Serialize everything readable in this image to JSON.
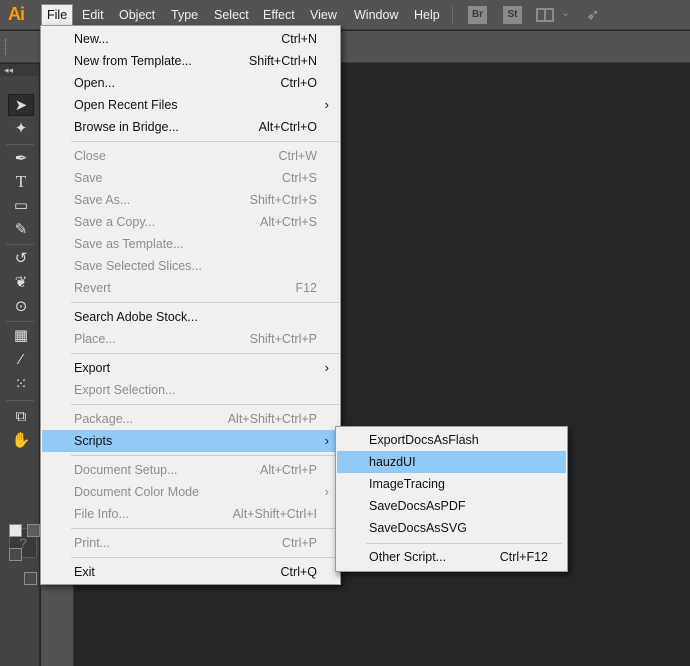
{
  "app": {
    "logo": "Ai",
    "bridge_badge": "Br",
    "stock_badge": "St"
  },
  "menubar": {
    "items": [
      "File",
      "Edit",
      "Object",
      "Type",
      "Select",
      "Effect",
      "View",
      "Window",
      "Help"
    ],
    "active": "File"
  },
  "tools_panel": {
    "collapse_label": "◂◂",
    "help_glyph": "?"
  },
  "file_menu": {
    "items": [
      {
        "label": "New...",
        "shortcut": "Ctrl+N",
        "enabled": true
      },
      {
        "label": "New from Template...",
        "shortcut": "Shift+Ctrl+N",
        "enabled": true
      },
      {
        "label": "Open...",
        "shortcut": "Ctrl+O",
        "enabled": true
      },
      {
        "label": "Open Recent Files",
        "submenu": true,
        "enabled": true
      },
      {
        "label": "Browse in Bridge...",
        "shortcut": "Alt+Ctrl+O",
        "enabled": true
      },
      {
        "label": "Close",
        "shortcut": "Ctrl+W",
        "enabled": false
      },
      {
        "label": "Save",
        "shortcut": "Ctrl+S",
        "enabled": false
      },
      {
        "label": "Save As...",
        "shortcut": "Shift+Ctrl+S",
        "enabled": false
      },
      {
        "label": "Save a Copy...",
        "shortcut": "Alt+Ctrl+S",
        "enabled": false
      },
      {
        "label": "Save as Template...",
        "enabled": false
      },
      {
        "label": "Save Selected Slices...",
        "enabled": false
      },
      {
        "label": "Revert",
        "shortcut": "F12",
        "enabled": false
      },
      {
        "label": "Search Adobe Stock...",
        "enabled": true
      },
      {
        "label": "Place...",
        "shortcut": "Shift+Ctrl+P",
        "enabled": false
      },
      {
        "label": "Export",
        "submenu": true,
        "enabled": true
      },
      {
        "label": "Export Selection...",
        "enabled": false
      },
      {
        "label": "Package...",
        "shortcut": "Alt+Shift+Ctrl+P",
        "enabled": false
      },
      {
        "label": "Scripts",
        "submenu": true,
        "enabled": true,
        "highlighted": true
      },
      {
        "label": "Document Setup...",
        "shortcut": "Alt+Ctrl+P",
        "enabled": false
      },
      {
        "label": "Document Color Mode",
        "submenu": true,
        "enabled": false
      },
      {
        "label": "File Info...",
        "shortcut": "Alt+Shift+Ctrl+I",
        "enabled": false
      },
      {
        "label": "Print...",
        "shortcut": "Ctrl+P",
        "enabled": false
      },
      {
        "label": "Exit",
        "shortcut": "Ctrl+Q",
        "enabled": true
      }
    ]
  },
  "scripts_menu": {
    "items": [
      {
        "label": "ExportDocsAsFlash"
      },
      {
        "label": "hauzdUI",
        "highlighted": true
      },
      {
        "label": "ImageTracing"
      },
      {
        "label": "SaveDocsAsPDF"
      },
      {
        "label": "SaveDocsAsSVG"
      },
      {
        "label": "Other Script...",
        "shortcut": "Ctrl+F12"
      }
    ]
  },
  "colors": {
    "menubar_bg": "#535353",
    "menu_bg": "#f0f0f0",
    "highlight": "#91c9f7",
    "disabled_text": "#8e8e8e",
    "logo": "#ff9a00",
    "canvas": "#262626"
  }
}
